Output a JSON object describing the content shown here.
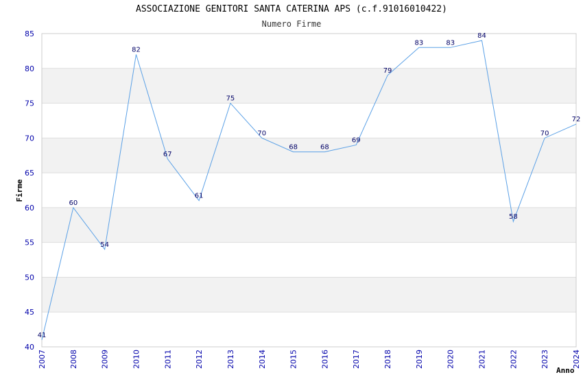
{
  "title": "ASSOCIAZIONE GENITORI SANTA CATERINA APS (c.f.91016010422)",
  "subtitle": "Numero Firme",
  "colors": {
    "line": "#5aa0e6",
    "band": "#f2f2f2",
    "grid": "#dddddd",
    "tick_text": "#0000aa",
    "label_text": "#000066"
  },
  "chart_data": {
    "type": "line",
    "title": "ASSOCIAZIONE GENITORI SANTA CATERINA APS (c.f.91016010422)",
    "subtitle": "Numero Firme",
    "xlabel": "Anno",
    "ylabel": "Firme",
    "x": [
      2007,
      2008,
      2009,
      2010,
      2011,
      2012,
      2013,
      2014,
      2015,
      2016,
      2017,
      2018,
      2019,
      2020,
      2021,
      2022,
      2023,
      2024
    ],
    "series": [
      {
        "values": [
          41,
          60,
          54,
          82,
          67,
          61,
          75,
          70,
          68,
          68,
          69,
          79,
          83,
          83,
          84,
          58,
          70,
          72
        ]
      }
    ],
    "ylim": [
      40,
      85
    ],
    "yticks": [
      40,
      45,
      50,
      55,
      60,
      65,
      70,
      75,
      80,
      85
    ],
    "grid": true,
    "data_labels": true,
    "alternating_bands": true
  }
}
